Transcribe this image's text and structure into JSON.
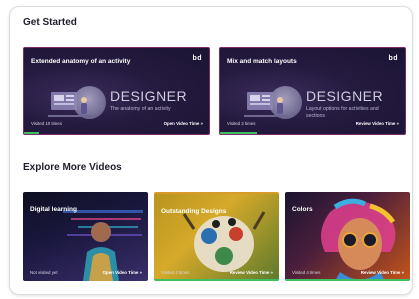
{
  "sections": {
    "get_started": "Get Started",
    "explore": "Explore More Videos"
  },
  "top_cards": [
    {
      "title": "Extended anatomy of an activity",
      "logo": "bd",
      "big": "DESIGNER",
      "sub": "The anatomy of an activity",
      "status": "Visited 10 times",
      "cta": "Open Video Time »",
      "progress": 0.08
    },
    {
      "title": "Mix and match layouts",
      "logo": "bd",
      "big": "DESIGNER",
      "sub": "Layout options for activities and sections",
      "status": "Visited 2 times",
      "cta": "Review Video Time »",
      "progress": 0.2
    }
  ],
  "video_cards": [
    {
      "title": "Digital learning",
      "status": "Not visited yet",
      "cta": "Open Video Time »",
      "progress": 0
    },
    {
      "title": "Outstanding Designs",
      "status": "Visited 4 times",
      "cta": "Review Video Time »",
      "progress": 1
    },
    {
      "title": "Colors",
      "status": "Visited 4 times",
      "cta": "Review Video Time »",
      "progress": 1
    }
  ],
  "colors": {
    "progress": "#3fbf60",
    "card_border_accent": "#7a2b6a"
  }
}
